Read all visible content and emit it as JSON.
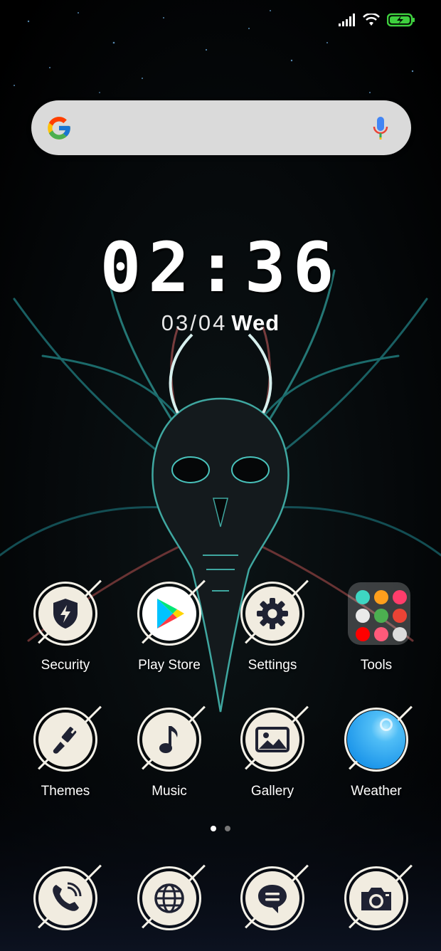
{
  "status_bar": {
    "signal_icon": "signal-bars-icon",
    "wifi_icon": "wifi-icon",
    "battery_icon": "battery-charging-icon",
    "battery_color": "#3ecf3e"
  },
  "search_bar": {
    "logo_icon": "google-g-icon",
    "mic_icon": "mic-icon"
  },
  "clock": {
    "time": "02:36",
    "date": "03/04",
    "day": "Wed"
  },
  "apps": [
    {
      "label": "Security",
      "icon": "shield-bolt-icon"
    },
    {
      "label": "Play Store",
      "icon": "play-store-icon"
    },
    {
      "label": "Settings",
      "icon": "gear-icon"
    },
    {
      "label": "Tools",
      "icon": "folder-icon"
    },
    {
      "label": "Themes",
      "icon": "paintbrush-icon"
    },
    {
      "label": "Music",
      "icon": "music-note-icon"
    },
    {
      "label": "Gallery",
      "icon": "image-icon"
    },
    {
      "label": "Weather",
      "icon": "weather-icon"
    }
  ],
  "pages": {
    "count": 2,
    "current": 1
  },
  "dock": [
    {
      "icon": "phone-icon"
    },
    {
      "icon": "globe-icon"
    },
    {
      "icon": "message-icon"
    },
    {
      "icon": "camera-icon"
    }
  ],
  "colors": {
    "accent_teal": "#2fb7b0",
    "icon_cream": "#f1ece0",
    "icon_glyph": "#1f2233"
  }
}
